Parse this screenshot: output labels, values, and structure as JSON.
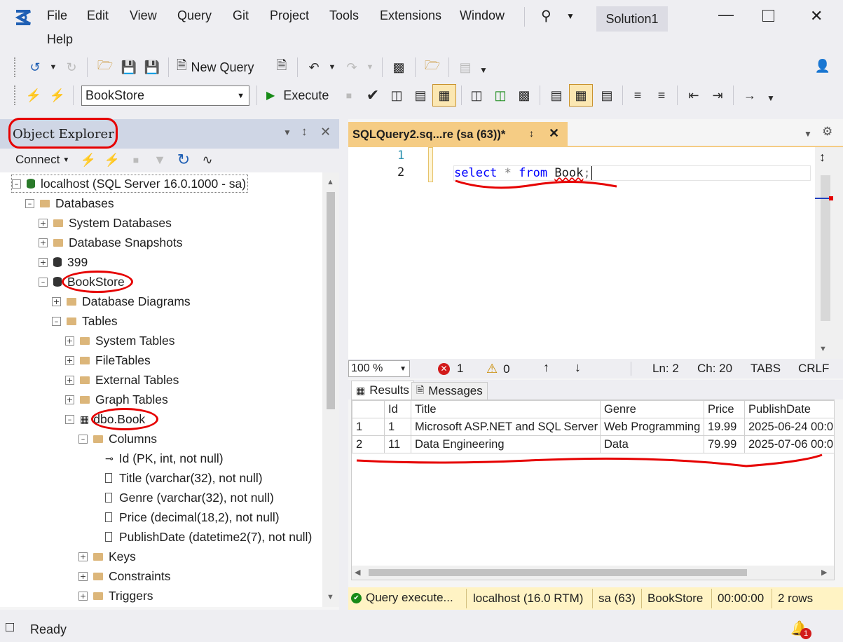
{
  "menu": {
    "items": [
      "File",
      "Edit",
      "View",
      "Query",
      "Git",
      "Project",
      "Tools",
      "Extensions",
      "Window",
      "Help"
    ],
    "solution": "Solution1"
  },
  "toolbar": {
    "new_query": "New Query",
    "database": "BookStore",
    "execute": "Execute"
  },
  "object_explorer": {
    "title": "Object Explorer",
    "connect": "Connect",
    "server": "localhost (SQL Server 16.0.1000 - sa)",
    "databases": "Databases",
    "system_databases": "System Databases",
    "snapshots": "Database Snapshots",
    "db_399": "399",
    "bookstore": "BookStore",
    "diagrams": "Database Diagrams",
    "tables": "Tables",
    "system_tables": "System Tables",
    "filetables": "FileTables",
    "external_tables": "External Tables",
    "graph_tables": "Graph Tables",
    "dbo_book": "dbo.Book",
    "columns": "Columns",
    "col_id": "Id (PK, int, not null)",
    "col_title": "Title (varchar(32), not null)",
    "col_genre": "Genre (varchar(32), not null)",
    "col_price": "Price (decimal(18,2), not null)",
    "col_publish": "PublishDate (datetime2(7), not null)",
    "keys": "Keys",
    "constraints": "Constraints",
    "triggers": "Triggers"
  },
  "editor": {
    "tab_title": "SQLQuery2.sq...re (sa (63))*",
    "line1": "1",
    "line2": "2",
    "kw_select": "select",
    "star": "*",
    "kw_from": "from",
    "table": "Book",
    "semicolon": ";",
    "zoom": "100 %",
    "errors": "1",
    "warnings": "0",
    "ln": "Ln: 2",
    "ch": "Ch: 20",
    "tabs": "TABS",
    "crlf": "CRLF"
  },
  "results": {
    "tab_results": "Results",
    "tab_messages": "Messages",
    "headers": [
      "Id",
      "Title",
      "Genre",
      "Price",
      "PublishDate"
    ],
    "rows": [
      {
        "num": "1",
        "id": "1",
        "title": "Microsoft ASP.NET and SQL Server",
        "genre": "Web Programming",
        "price": "19.99",
        "date": "2025-06-24 00:0"
      },
      {
        "num": "2",
        "id": "11",
        "title": "Data Engineering",
        "genre": "Data",
        "price": "79.99",
        "date": "2025-07-06 00:0"
      }
    ]
  },
  "query_status": {
    "status": "Query  execute...",
    "server": "localhost (16.0 RTM)",
    "user": "sa (63)",
    "db": "BookStore",
    "time": "00:00:00",
    "rows": "2 rows"
  },
  "statusbar": {
    "ready": "Ready",
    "notifications": "1"
  },
  "colors": {
    "accent_tab": "#f5cc84",
    "keyword": "#0000ff",
    "annotation": "#e60000",
    "brand": "#1f5fb4"
  }
}
